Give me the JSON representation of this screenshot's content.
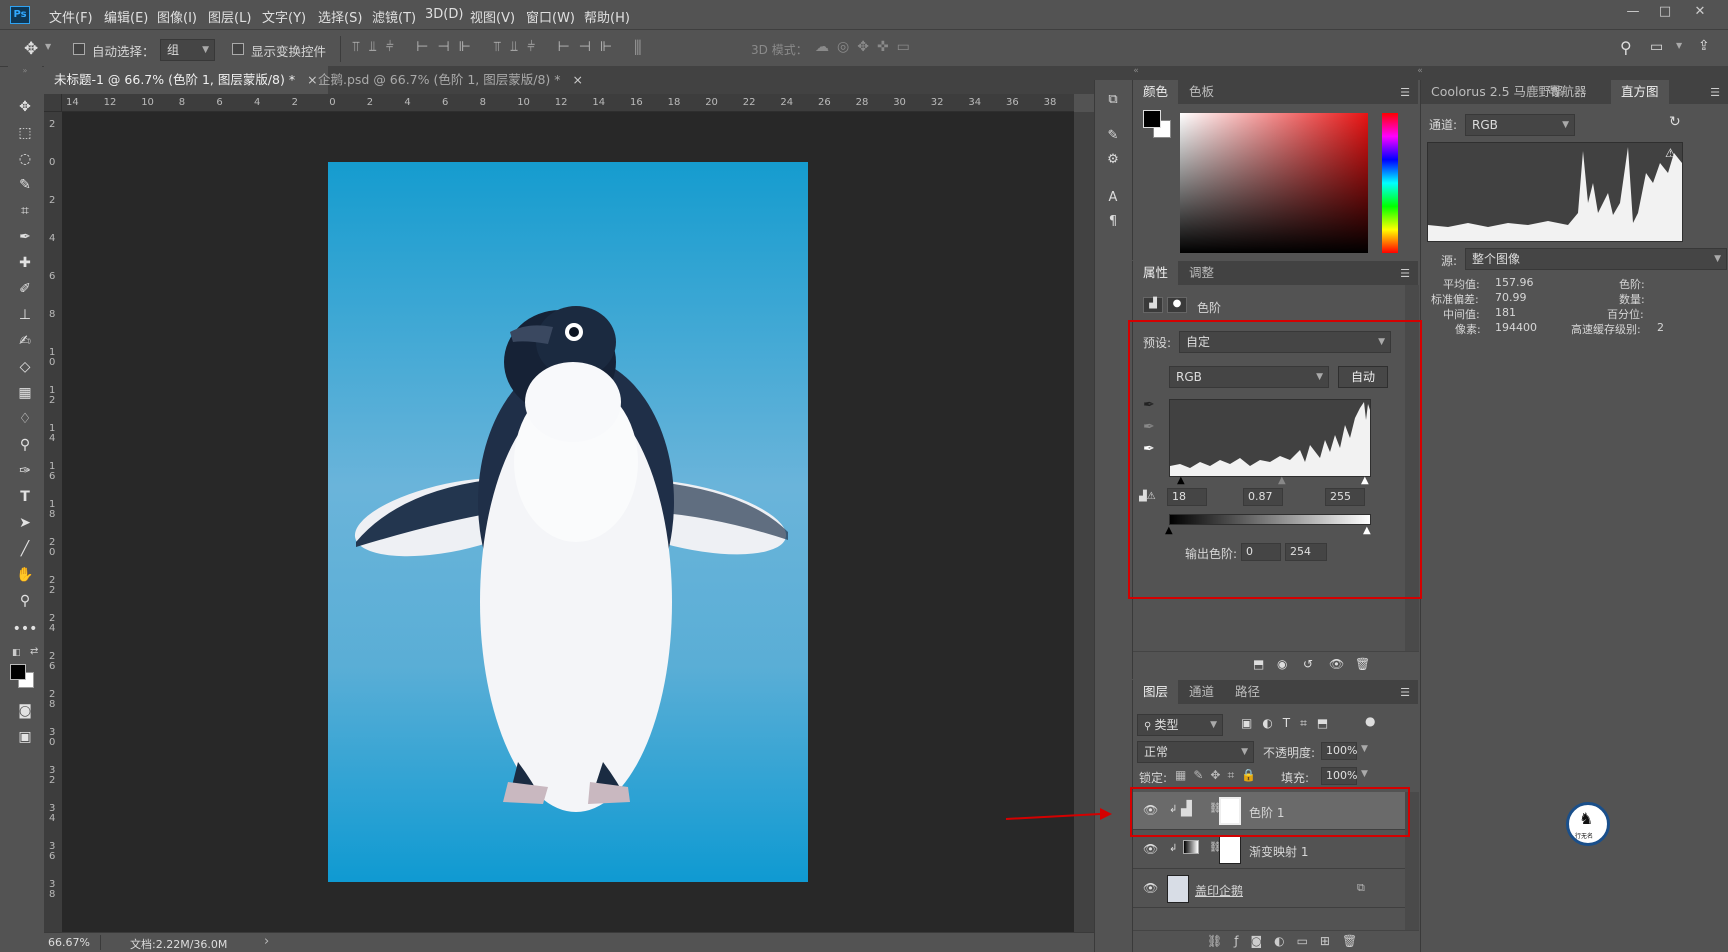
{
  "menu": {
    "items": [
      "文件(F)",
      "编辑(E)",
      "图像(I)",
      "图层(L)",
      "文字(Y)",
      "选择(S)",
      "滤镜(T)",
      "3D(D)",
      "视图(V)",
      "窗口(W)",
      "帮助(H)"
    ],
    "logo": "Ps"
  },
  "options": {
    "auto_select_label": "自动选择：",
    "auto_select_value": "组",
    "show_transform_label": "显示变换控件",
    "mode_3d_label": "3D 模式："
  },
  "tabs": [
    {
      "label": "未标题-1 @ 66.7% (色阶 1, 图层蒙版/8) *",
      "close": "×"
    },
    {
      "label": "企鹅.psd @ 66.7% (色阶 1, 图层蒙版/8) *",
      "close": "×"
    }
  ],
  "ruler": {
    "top_ticks": [
      "14",
      "12",
      "10",
      "8",
      "6",
      "4",
      "2",
      "0",
      "2",
      "4",
      "6",
      "8",
      "10",
      "12",
      "14",
      "16",
      "18",
      "20",
      "22",
      "24",
      "26",
      "28",
      "30",
      "32",
      "34",
      "36",
      "38"
    ],
    "left_ticks": [
      "2",
      "0",
      "2",
      "4",
      "6",
      "8",
      "1 0",
      "1 2",
      "1 4",
      "1 6",
      "1 8",
      "2 0",
      "2 2",
      "2 4",
      "2 6",
      "2 8",
      "3 0",
      "3 2",
      "3 4",
      "3 6",
      "3 8"
    ]
  },
  "status": {
    "zoom": "66.67%",
    "doc": "文档:2.22M/36.0M",
    "arrow": "›"
  },
  "color_panel": {
    "tabs": [
      "颜色",
      "色板"
    ],
    "fg_color": "#000000",
    "bg_color": "#ffffff",
    "hue_color": "#e81313"
  },
  "props_panel": {
    "tabs": [
      "属性",
      "调整"
    ],
    "title": "色阶",
    "preset_label": "预设:",
    "preset_value": "自定",
    "channel_value": "RGB",
    "auto_button": "自动",
    "input_black": "18",
    "input_gamma": "0.87",
    "input_white": "255",
    "output_label": "输出色阶:",
    "output_black": "0",
    "output_white": "254"
  },
  "layers_panel": {
    "tabs": [
      "图层",
      "通道",
      "路径"
    ],
    "filter_value": "类型",
    "blend_mode": "正常",
    "opacity_label": "不透明度:",
    "opacity_value": "100%",
    "lock_label": "锁定:",
    "fill_label": "填充:",
    "fill_value": "100%",
    "layers": [
      {
        "name": "色阶 1",
        "selected": true
      },
      {
        "name": "渐变映射 1",
        "selected": false
      },
      {
        "name": "盖印企鹅",
        "selected": false
      }
    ]
  },
  "histogram_panel": {
    "tabs": [
      "Coolorus 2.5 马鹿野郎",
      "导航器",
      "直方图"
    ],
    "channel_label": "通道:",
    "channel_value": "RGB",
    "source_label": "源:",
    "source_value": "整个图像",
    "stats": [
      {
        "label": "平均值:",
        "value": "157.96"
      },
      {
        "label": "标准偏差:",
        "value": "70.99"
      },
      {
        "label": "中间值:",
        "value": "181"
      },
      {
        "label": "像素:",
        "value": "194400"
      }
    ],
    "stats_right": [
      {
        "label": "色阶:",
        "value": ""
      },
      {
        "label": "数量:",
        "value": ""
      },
      {
        "label": "百分位:",
        "value": ""
      },
      {
        "label": "高速缓存级别:",
        "value": "2"
      }
    ]
  },
  "watermark": {
    "text": "行无名"
  },
  "annotation": {
    "accent": "#d40000"
  }
}
